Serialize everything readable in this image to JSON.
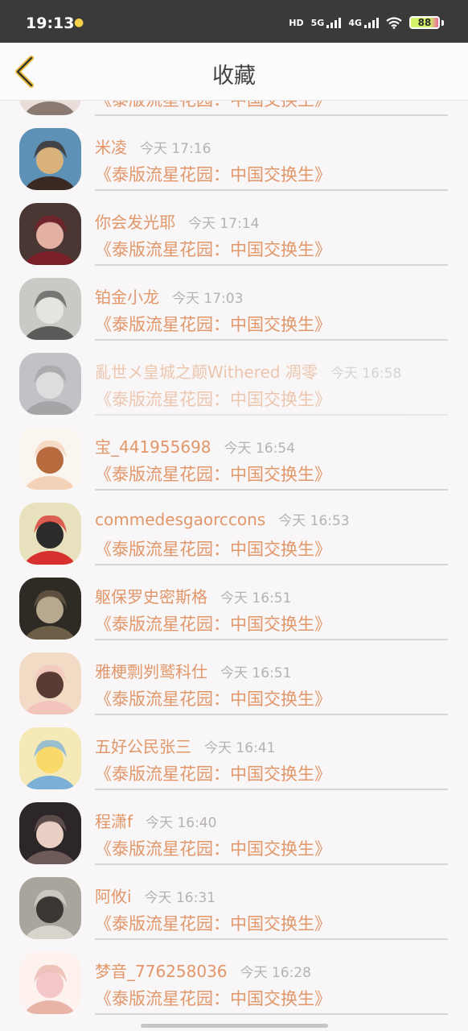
{
  "status_bar": {
    "time": "19:13",
    "hd_label": "HD",
    "net1_label": "5G",
    "net2_label": "4G",
    "battery": "88"
  },
  "header": {
    "title": "收藏",
    "back_icon": "chevron-left-icon",
    "accent_color": "#e2b436"
  },
  "colors": {
    "name": "#e2976a",
    "time": "#b5b2b2",
    "background": "#f8f6f7"
  },
  "favorites": [
    {
      "name": "",
      "time": "",
      "work": "《泰版流星花园：中国交换生》",
      "avatar_colors": [
        "#e8ddd8",
        "#b8a8a0",
        "#8a7a72"
      ],
      "faded": false
    },
    {
      "name": "米凌",
      "time": "今天 17:16",
      "work": "《泰版流星花园：中国交换生》",
      "avatar_colors": [
        "#5d92b6",
        "#d9b27c",
        "#3a2a22"
      ],
      "faded": false
    },
    {
      "name": "你会发光耶",
      "time": "今天 17:14",
      "work": "《泰版流星花园：中国交换生》",
      "avatar_colors": [
        "#4a3633",
        "#e3b1a4",
        "#7a1f28"
      ],
      "faded": false
    },
    {
      "name": "铂金小龙",
      "time": "今天 17:03",
      "work": "《泰版流星花园：中国交换生》",
      "avatar_colors": [
        "#c9c9c6",
        "#e6e4e0",
        "#5a5a58"
      ],
      "faded": false
    },
    {
      "name": "亂世メ皇城之颠Withered 凋零",
      "time": "今天 16:58",
      "work": "《泰版流星花园：中国交换生》",
      "avatar_colors": [
        "#8c8f95",
        "#c6c3c4",
        "#55575c"
      ],
      "faded": true
    },
    {
      "name": "宝_441955698",
      "time": "今天 16:54",
      "work": "《泰版流星花园：中国交换生》",
      "avatar_colors": [
        "#fbf5ef",
        "#b76a3e",
        "#f3d2b8"
      ],
      "faded": false
    },
    {
      "name": "commedesgaorccons",
      "time": "今天 16:53",
      "work": "《泰版流星花园：中国交换生》",
      "avatar_colors": [
        "#e7e2bd",
        "#2b2b2b",
        "#d8302f"
      ],
      "faded": false
    },
    {
      "name": "躯保罗史密斯格",
      "time": "今天 16:51",
      "work": "《泰版流星花园：中国交换生》",
      "avatar_colors": [
        "#2e2a24",
        "#b8a890",
        "#6d5e48"
      ],
      "faded": false
    },
    {
      "name": "雅梗剽刿鹫科仕",
      "time": "今天 16:51",
      "work": "《泰版流星花园：中国交换生》",
      "avatar_colors": [
        "#f1dbc4",
        "#5a3b33",
        "#f2c4bc"
      ],
      "faded": false
    },
    {
      "name": "五好公民张三",
      "time": "今天 16:41",
      "work": "《泰版流星花园：中国交换生》",
      "avatar_colors": [
        "#f6e9b8",
        "#f8d96a",
        "#7ab0d8"
      ],
      "faded": false
    },
    {
      "name": "程潇f",
      "time": "今天 16:40",
      "work": "《泰版流星花园：中国交换生》",
      "avatar_colors": [
        "#2c2628",
        "#e9cfc4",
        "#6e5a58"
      ],
      "faded": false
    },
    {
      "name": "阿攸i",
      "time": "今天 16:31",
      "work": "《泰版流星花园：中国交换生》",
      "avatar_colors": [
        "#a9a59c",
        "#3a3734",
        "#d8d4cc"
      ],
      "faded": false
    },
    {
      "name": "梦音_776258036",
      "time": "今天 16:28",
      "work": "《泰版流星花园：中国交换生》",
      "avatar_colors": [
        "#fdf2ee",
        "#f3c6c8",
        "#e8b4a8"
      ],
      "faded": false
    }
  ]
}
